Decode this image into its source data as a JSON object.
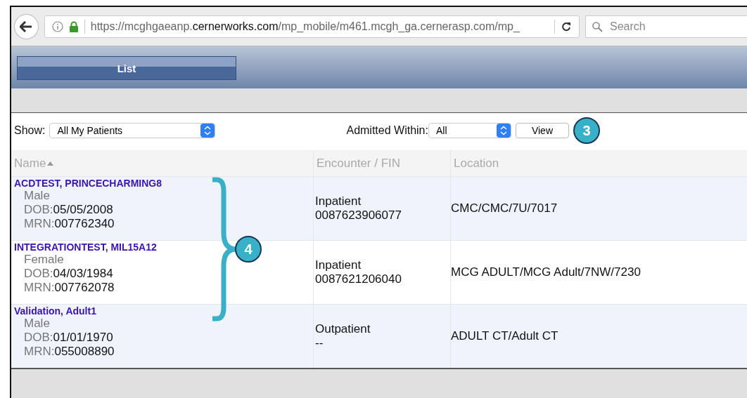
{
  "browser": {
    "url_scheme": "https://mcghgaeanp.",
    "url_domain": "cernerworks.com",
    "url_path": "/mp_mobile/m461.mcgh_ga.cernerasp.com/mp_",
    "search_placeholder": "Search"
  },
  "tabs": [
    {
      "label": "List",
      "selected": true
    }
  ],
  "filters": {
    "show_label": "Show:",
    "show_value": "All My Patients",
    "admitted_label": "Admitted Within:",
    "admitted_value": "All",
    "view_button": "View"
  },
  "table": {
    "columns": [
      {
        "label": "Name",
        "sorted": true
      },
      {
        "label": "Encounter / FIN",
        "sorted": false
      },
      {
        "label": "Location",
        "sorted": false
      }
    ],
    "rows": [
      {
        "name": "ACDTEST, PRINCECHARMING8",
        "sex": "Male",
        "dob_label": "DOB:",
        "dob": "05/05/2008",
        "mrn_label": "MRN:",
        "mrn": "007762340",
        "encounter": "Inpatient",
        "fin": "0087623906077",
        "location": "CMC/CMC/7U/7017"
      },
      {
        "name": "INTEGRATIONTEST, MIL15A12",
        "sex": "Female",
        "dob_label": "DOB:",
        "dob": "04/03/1984",
        "mrn_label": "MRN:",
        "mrn": "007762078",
        "encounter": "Inpatient",
        "fin": "0087621206040",
        "location": "MCG ADULT/MCG Adult/7NW/7230"
      },
      {
        "name": "Validation, Adult1",
        "sex": "Male",
        "dob_label": "DOB:",
        "dob": "01/01/1970",
        "mrn_label": "MRN:",
        "mrn": "055008890",
        "encounter": "Outpatient",
        "fin": "--",
        "location": "ADULT CT/Adult CT"
      }
    ]
  },
  "callouts": [
    {
      "number": "3"
    },
    {
      "number": "4"
    }
  ]
}
